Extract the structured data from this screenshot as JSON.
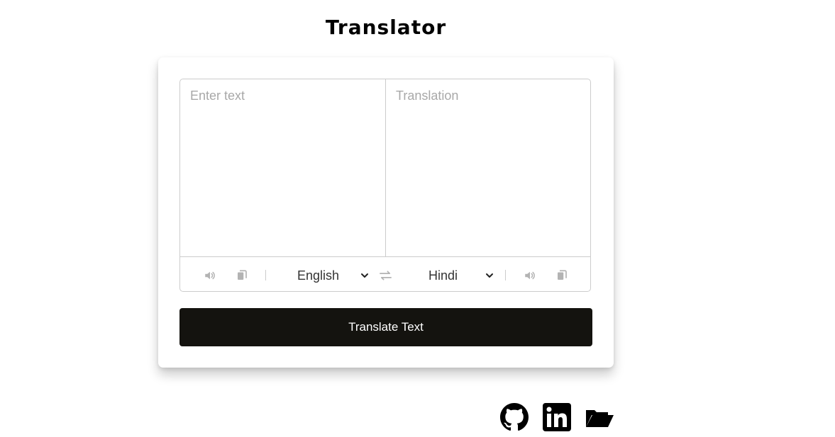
{
  "page": {
    "title": "Translator"
  },
  "translator": {
    "input_placeholder": "Enter text",
    "output_placeholder": "Translation",
    "input_value": "",
    "output_value": "",
    "from_language": "English",
    "to_language": "Hindi",
    "translate_button_label": "Translate Text"
  },
  "icons": {
    "speak": "volume-icon",
    "copy": "copy-icon",
    "swap": "exchange-icon",
    "dropdown": "chevron-down-icon"
  },
  "footer": {
    "links": [
      {
        "name": "github-icon"
      },
      {
        "name": "linkedin-icon"
      },
      {
        "name": "folder-icon"
      }
    ]
  },
  "colors": {
    "button_bg": "#14130f",
    "icon_muted": "#b0b0b0",
    "border": "#cccccc"
  }
}
